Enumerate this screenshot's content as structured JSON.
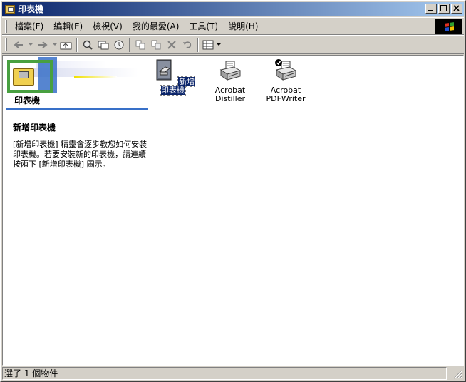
{
  "window": {
    "title": "印表機",
    "buttons": {
      "minimize": "_",
      "maximize": "□",
      "close": "×"
    }
  },
  "menubar": {
    "items": [
      {
        "label": "檔案(F)"
      },
      {
        "label": "編輯(E)"
      },
      {
        "label": "檢視(V)"
      },
      {
        "label": "我的最愛(A)"
      },
      {
        "label": "工具(T)"
      },
      {
        "label": "說明(H)"
      }
    ]
  },
  "toolbar": {
    "icons": [
      "back-icon",
      "forward-icon",
      "up-folder-icon",
      "search-icon",
      "folders-icon",
      "history-icon",
      "move-to-icon",
      "copy-to-icon",
      "delete-icon",
      "undo-icon",
      "views-icon"
    ]
  },
  "left_pane": {
    "title": "印表機",
    "heading": "新增印表機",
    "body": "[新增印表機] 精靈會逐步教您如何安裝印表機。若要安裝新的印表機，請連續按兩下 [新增印表機] 圖示。"
  },
  "items": [
    {
      "label": "新增印表機",
      "selected": true,
      "icon": "add-printer-icon"
    },
    {
      "label_line1": "Acrobat",
      "label_line2": "Distiller",
      "icon": "printer-icon"
    },
    {
      "label_line1": "Acrobat",
      "label_line2": "PDFWriter",
      "icon": "default-printer-icon"
    }
  ],
  "statusbar": {
    "text": "選了 1 個物件"
  },
  "colors": {
    "title_start": "#0a246a",
    "title_end": "#a6caf0",
    "face": "#d4d0c8",
    "selection": "#0a246a"
  }
}
